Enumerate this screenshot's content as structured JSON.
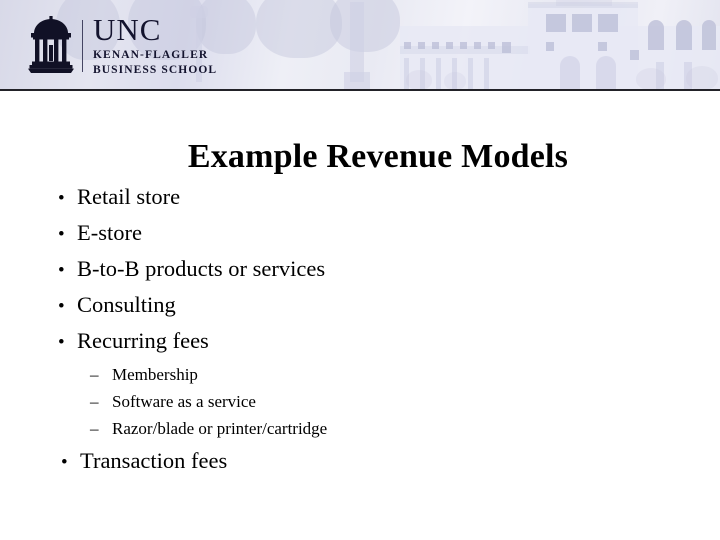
{
  "slide": {
    "title": "Example Revenue Models",
    "background_color": "#ffffff",
    "text_color": "#000000"
  },
  "header": {
    "banner_gradient_from": "#d8d9e8",
    "banner_gradient_to": "#f3f3f9",
    "rule_color": "#222228",
    "logo": {
      "icon_name": "old-well-rotunda-icon",
      "wordmark": "UNC",
      "line2": "KENAN-FLAGLER",
      "line3": "BUSINESS SCHOOL",
      "color": "#13132e"
    }
  },
  "content": {
    "bullet_glyph": "•",
    "dash_glyph": "–",
    "items": [
      {
        "level": 1,
        "text": "Retail store"
      },
      {
        "level": 1,
        "text": "E-store"
      },
      {
        "level": 1,
        "text": "B-to-B products or services"
      },
      {
        "level": 1,
        "text": "Consulting"
      },
      {
        "level": 1,
        "text": "Recurring fees"
      },
      {
        "level": 2,
        "text": "Membership"
      },
      {
        "level": 2,
        "text": "Software as a service"
      },
      {
        "level": 2,
        "text": "Razor/blade or printer/cartridge"
      },
      {
        "level": 1,
        "text": "Transaction fees"
      }
    ]
  }
}
